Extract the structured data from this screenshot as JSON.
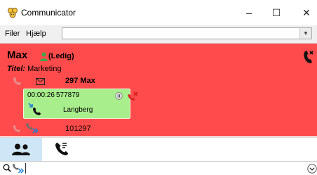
{
  "window": {
    "title": "Communicator",
    "minimize": "–",
    "maximize": "☐",
    "close": "✕"
  },
  "menu": {
    "file": "Filer",
    "help": "Hjælp",
    "combo_value": ""
  },
  "contact": {
    "name": "Max",
    "status": "(Ledig)",
    "title_label": "Titel:",
    "title_value": "Marketing",
    "extension": "297 Max",
    "call": {
      "timer": "00:00:26",
      "number": "577879",
      "name": "Langberg"
    },
    "other_number": "101297"
  },
  "colors": {
    "panel": "#ff4b4b",
    "call_card": "#a8ee8c",
    "active_tab": "#cfe6f6",
    "presence": "#3fa64a"
  },
  "tabs": [
    {
      "id": "contacts",
      "icon": "people-icon",
      "active": true
    },
    {
      "id": "calls",
      "icon": "phone-icon",
      "active": false
    }
  ],
  "search": {
    "value": "",
    "placeholder": ""
  }
}
